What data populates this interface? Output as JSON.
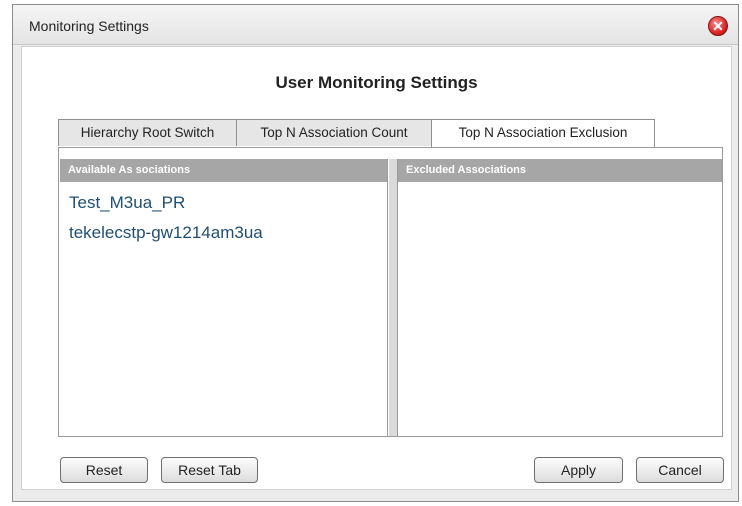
{
  "window": {
    "title": "Monitoring Settings"
  },
  "heading": "User Monitoring Settings",
  "tabs": [
    {
      "label": "Hierarchy Root Switch",
      "active": false
    },
    {
      "label": "Top N Association Count",
      "active": false
    },
    {
      "label": "Top N Association Exclusion",
      "active": true
    }
  ],
  "available": {
    "header": "Available As sociations",
    "items": [
      "Test_M3ua_PR",
      "tekelecstp-gw1214am3ua"
    ]
  },
  "excluded": {
    "header": "Excluded Associations",
    "items": []
  },
  "buttons": {
    "reset": "Reset",
    "reset_tab": "Reset Tab",
    "apply": "Apply",
    "cancel": "Cancel"
  },
  "colors": {
    "close": "#d11a1a",
    "list_text": "#1f4f72",
    "header_bg": "#a6a6a6"
  }
}
